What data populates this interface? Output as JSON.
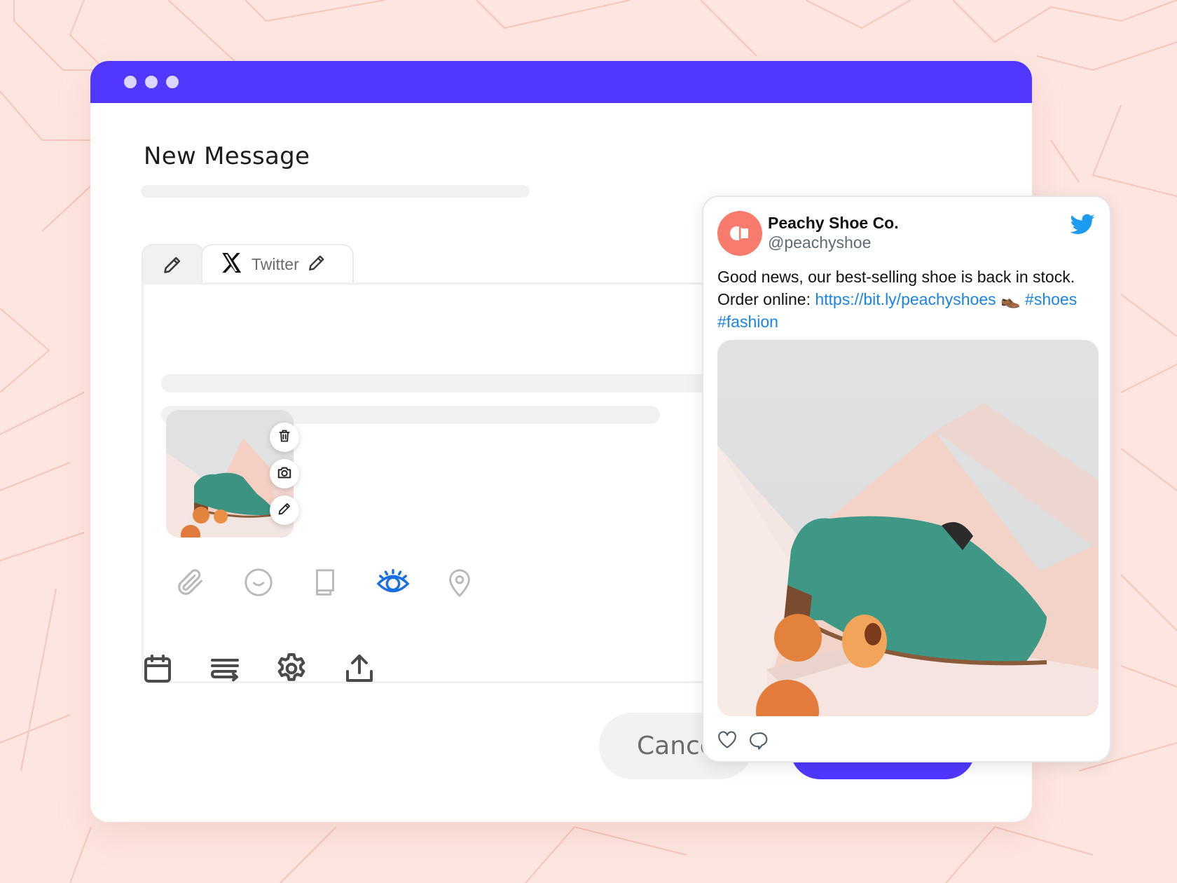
{
  "window": {
    "title": "New Message",
    "titlebar_color": "#5038ff",
    "dots": 3
  },
  "composer": {
    "tabs": [
      {
        "id": "general",
        "icon": "pencil-icon",
        "label": ""
      },
      {
        "id": "twitter",
        "icon": "x-logo-icon",
        "label": "Twitter",
        "edit_icon": "pencil-icon"
      }
    ],
    "attachment_actions": [
      "trash-icon",
      "camera-icon",
      "pencil-icon"
    ],
    "toolbar": [
      {
        "name": "attach",
        "icon": "paperclip-icon",
        "active": false
      },
      {
        "name": "emoji",
        "icon": "smiley-icon",
        "active": false
      },
      {
        "name": "library",
        "icon": "book-icon",
        "active": false
      },
      {
        "name": "preview",
        "icon": "eye-icon",
        "active": true
      },
      {
        "name": "location",
        "icon": "map-pin-icon",
        "active": false
      }
    ],
    "bottom_actions": [
      {
        "name": "schedule",
        "icon": "calendar-icon"
      },
      {
        "name": "queue",
        "icon": "lines-arrow-icon"
      },
      {
        "name": "settings",
        "icon": "gear-icon"
      },
      {
        "name": "upload",
        "icon": "upload-icon"
      }
    ],
    "cancel_label": "Cancel",
    "accent_active": "#1a6fe0"
  },
  "preview": {
    "account_name": "Peachy Shoe Co.",
    "handle": "@peachyshoe",
    "avatar_color": "#f97b6d",
    "text_plain_1": "Good news, our best-selling shoe is back in stock.",
    "text_plain_2": "Order online: ",
    "link": "https://bit.ly/peachyshoes",
    "emoji": "👞",
    "hashtag_1": "#shoes",
    "hashtag_2": "#fashion",
    "link_color": "#1a84e5",
    "twitter_color": "#1d9bf0"
  }
}
